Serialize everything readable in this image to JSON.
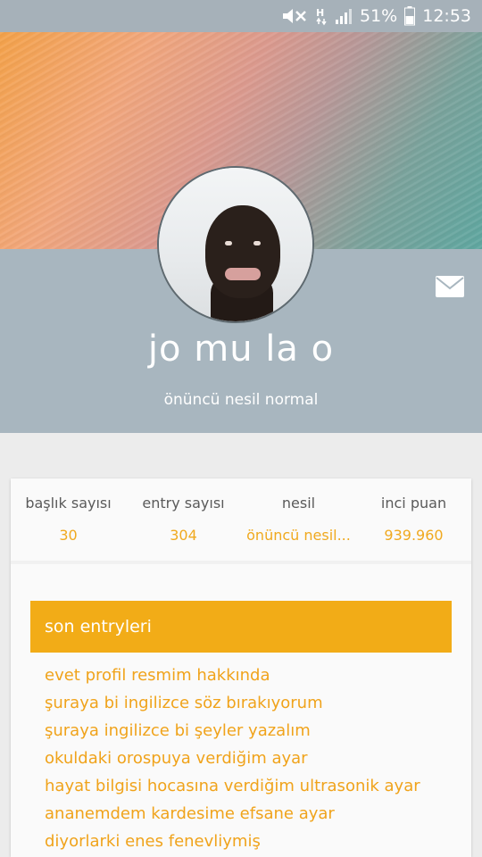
{
  "status_bar": {
    "battery_percent": "51%",
    "time": "12:53",
    "icons": [
      "mute-icon",
      "network-h-icon",
      "signal-icon",
      "battery-icon"
    ]
  },
  "profile": {
    "username": "jo mu la o",
    "subtitle": "önüncü nesil normal",
    "mail_icon": "mail-icon"
  },
  "stats": [
    {
      "label": "başlık sayısı",
      "value": "30"
    },
    {
      "label": "entry sayısı",
      "value": "304"
    },
    {
      "label": "nesil",
      "value": "önüncü nesil..."
    },
    {
      "label": "inci puan",
      "value": "939.960"
    }
  ],
  "entries": {
    "title": "son entryleri",
    "items": [
      "evet profil resmim hakkında",
      "şuraya bi ingilizce söz bırakıyorum",
      "şuraya ingilizce bi şeyler yazalım",
      "okuldaki orospuya verdiğim ayar",
      "hayat bilgisi hocasına verdiğim ultrasonik ayar",
      "ananemdem kardesime efsane ayar",
      "diyorlarki enes fenevliymiş"
    ]
  },
  "colors": {
    "accent": "#f2ac17",
    "status_bar": "#a6b1b9",
    "profile_band": "#a8b6bf"
  }
}
